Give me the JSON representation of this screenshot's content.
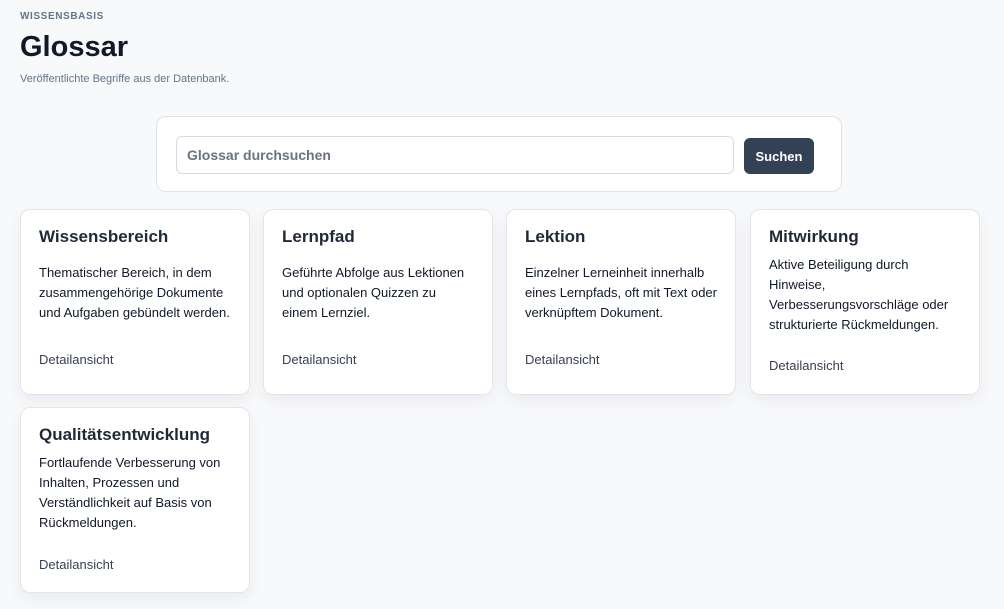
{
  "header": {
    "eyebrow": "WISSENSBASIS",
    "title": "Glossar",
    "subtitle": "Veröffentlichte Begriffe aus der Datenbank."
  },
  "search": {
    "placeholder": "Glossar durchsuchen",
    "value": "",
    "button_label": "Suchen"
  },
  "cards": [
    {
      "title": "Wissensbereich",
      "description": "Thematischer Bereich, in dem zusammengehörige Dokumente und Aufgaben gebündelt werden.",
      "link": "Detailansicht"
    },
    {
      "title": "Lernpfad",
      "description": "Geführte Abfolge aus Lektionen und optionalen Quizzen zu einem Lernziel.",
      "link": "Detailansicht"
    },
    {
      "title": "Lektion",
      "description": "Einzelner Lerneinheit innerhalb eines Lernpfads, oft mit Text oder verknüpftem Dokument.",
      "link": "Detailansicht"
    },
    {
      "title": "Mitwirkung",
      "description": "Aktive Beteiligung durch Hinweise, Verbesserungsvorschläge oder strukturierte Rückmeldungen.",
      "link": "Detailansicht"
    },
    {
      "title": "Qualitätsentwicklung",
      "description": "Fortlaufende Verbesserung von Inhalten, Prozessen und Verständlichkeit auf Basis von Rückmeldungen.",
      "link": "Detailansicht"
    }
  ]
}
